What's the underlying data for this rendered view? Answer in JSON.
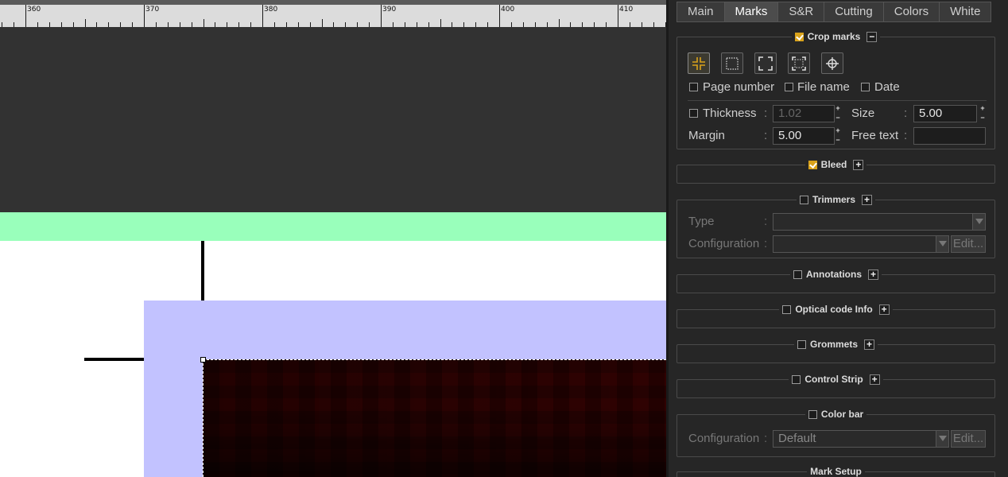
{
  "ruler": {
    "labels": [
      "360",
      "370",
      "380",
      "390",
      "400",
      "410"
    ]
  },
  "tabs": [
    {
      "label": "Main",
      "active": false
    },
    {
      "label": "Marks",
      "active": true
    },
    {
      "label": "S&R",
      "active": false
    },
    {
      "label": "Cutting",
      "active": false
    },
    {
      "label": "Colors",
      "active": false
    },
    {
      "label": "White",
      "active": false
    }
  ],
  "crop_marks": {
    "title": "Crop marks",
    "enabled": true,
    "toggle": "−",
    "page_number": "Page number",
    "file_name": "File name",
    "date": "Date",
    "thickness_label": "Thickness",
    "thickness_value": "1.02",
    "size_label": "Size",
    "size_value": "5.00",
    "margin_label": "Margin",
    "margin_value": "5.00",
    "free_text_label": "Free text",
    "free_text_value": ""
  },
  "bleed": {
    "title": "Bleed",
    "enabled": true,
    "toggle": "+"
  },
  "trimmers": {
    "title": "Trimmers",
    "enabled": false,
    "toggle": "+",
    "type_label": "Type",
    "configuration_label": "Configuration",
    "edit_label": "Edit..."
  },
  "annotations": {
    "title": "Annotations",
    "toggle": "+"
  },
  "optical_code": {
    "title": "Optical code Info",
    "toggle": "+"
  },
  "grommets": {
    "title": "Grommets",
    "toggle": "+"
  },
  "control_strip": {
    "title": "Control Strip",
    "toggle": "+"
  },
  "color_bar": {
    "title": "Color bar",
    "configuration_label": "Configuration",
    "configuration_value": "Default",
    "edit_label": "Edit..."
  },
  "mark_setup": {
    "title": "Mark Setup"
  },
  "colon": ":",
  "colors": {
    "accent": "#d9a21a",
    "green_band": "#99ffbb",
    "bleed_area": "#c2c2ff",
    "image": "#2a0303"
  }
}
